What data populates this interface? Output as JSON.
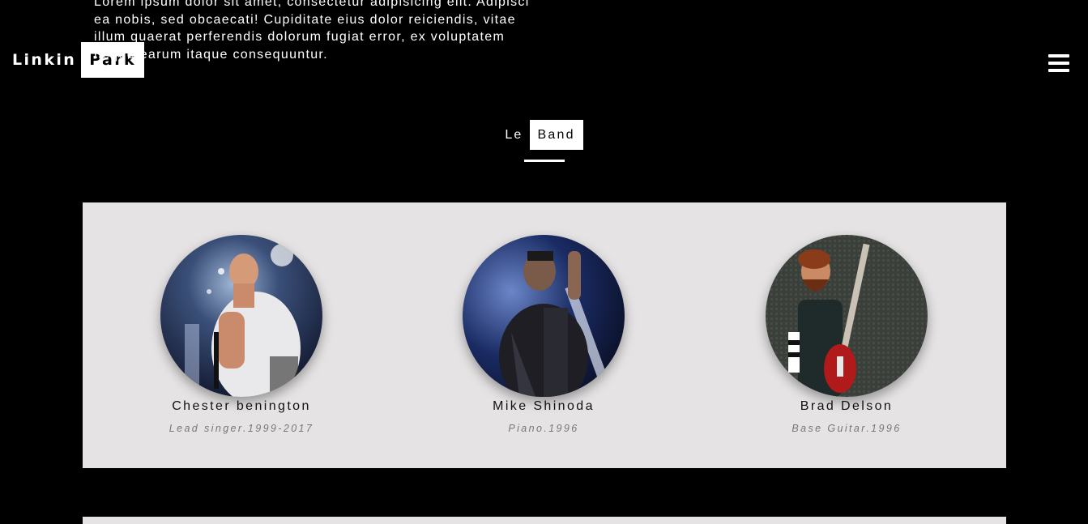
{
  "intro": {
    "text": "Lorem ipsum dolor sit amet, consectetur adipisicing elit. Adipisci ea nobis, sed obcaecati! Cupiditate eius dolor reiciendis, vitae illum quaerat perferendis dolorum fugiat error, ex voluptatem neque earum itaque consequuntur."
  },
  "logo": {
    "first": "Linkin",
    "second": "Park"
  },
  "menu": {
    "icon": "hamburger-icon"
  },
  "section": {
    "title_first": "Le",
    "title_second": "Band"
  },
  "members": [
    {
      "name": "Chester benington",
      "role": "Lead singer.1999-2017"
    },
    {
      "name": "Mike Shinoda",
      "role": "Piano.1996"
    },
    {
      "name": "Brad Delson",
      "role": "Base Guitar.1996"
    }
  ],
  "colors": {
    "background": "#000000",
    "panel": "#e5e3e4",
    "accent": "#ffffff",
    "role_text": "#777777"
  }
}
